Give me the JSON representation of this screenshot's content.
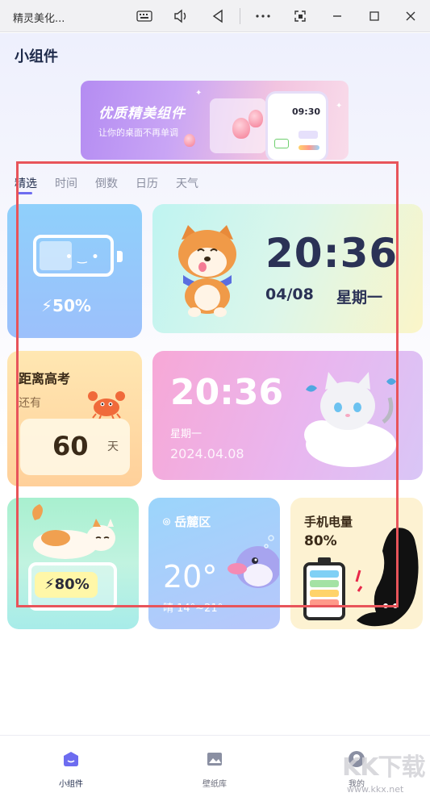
{
  "window": {
    "title": "精灵美化...",
    "icons": [
      "keyboard-icon",
      "volume-icon",
      "back-icon",
      "more-icon",
      "screenshot-icon",
      "minimize-icon",
      "maximize-icon",
      "close-icon"
    ]
  },
  "page": {
    "title": "小组件"
  },
  "banner": {
    "title": "优质精美组件",
    "subtitle": "让你的桌面不再单调",
    "clock": "09:30"
  },
  "tabs": [
    "精选",
    "时间",
    "倒数",
    "日历",
    "天气"
  ],
  "active_tab": 0,
  "widgets": {
    "battery": {
      "percent": "50%"
    },
    "clock1": {
      "time": "20:36",
      "date": "04/08",
      "weekday": "星期一"
    },
    "exam": {
      "title": "距离高考",
      "sub": "还有",
      "days": "60",
      "unit": "天"
    },
    "clock2": {
      "time": "20:36",
      "weekday": "星期一",
      "date": "2024.04.08"
    },
    "cat_battery": {
      "percent": "80%"
    },
    "weather": {
      "location": "岳麓区",
      "temp": "20°",
      "range": "晴 14°~21°"
    },
    "phone_battery": {
      "title": "手机电量",
      "percent": "80%"
    }
  },
  "bottom_nav": [
    {
      "label": "小组件",
      "icon": "widget-icon"
    },
    {
      "label": "壁纸库",
      "icon": "wallpaper-icon"
    },
    {
      "label": "我的",
      "icon": "profile-icon"
    }
  ],
  "watermark": {
    "text": "KK下载",
    "url": "www.kkx.net"
  },
  "colors": {
    "accent": "#6d6cf0",
    "selection": "#e8545a"
  }
}
